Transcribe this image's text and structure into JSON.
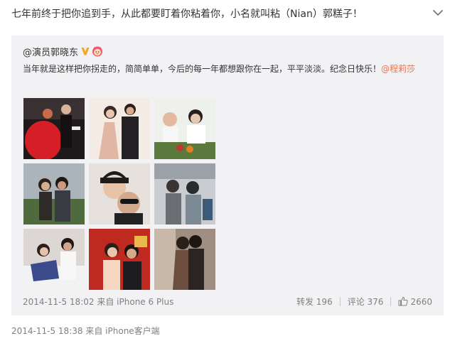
{
  "post": {
    "text": "七年前终于把你追到手，从此都要盯着你粘着你，小名就叫粘（Nian）郭糕子！",
    "time": "2014-11-5 18:38",
    "source_prefix": "来自",
    "source": "iPhone客户端"
  },
  "repost": {
    "author": "@演员郭晓东",
    "text": "当年就是这样把你拐走的，简简单单，今后的每一年都想跟你在一起，平平淡淡。纪念日快乐！",
    "mention": "@程莉莎",
    "time": "2014-11-5 18:02",
    "source_prefix": "来自",
    "source": "iPhone 6 Plus",
    "repost_label": "转发 196",
    "comment_label": "评论 376",
    "like_count": "2660",
    "thumbnails": [
      "wedding-couple-red-dress",
      "couple-portrait-pink-dress",
      "family-dinner-table",
      "couple-outdoor-selfie",
      "couple-selfie-caps",
      "couple-airport",
      "couple-on-sofa",
      "couple-red-background",
      "couple-embrace"
    ]
  },
  "colors": {
    "text": "#333333",
    "meta": "#808080",
    "mention": "#eb7350",
    "repost_bg": "#f2f2f5",
    "badge_v": "#f5a623",
    "page_bg": "#ffffff"
  },
  "icons": [
    "chevron-down-icon",
    "verified-v-icon",
    "emoji-badge-icon",
    "thumbs-up-icon"
  ]
}
